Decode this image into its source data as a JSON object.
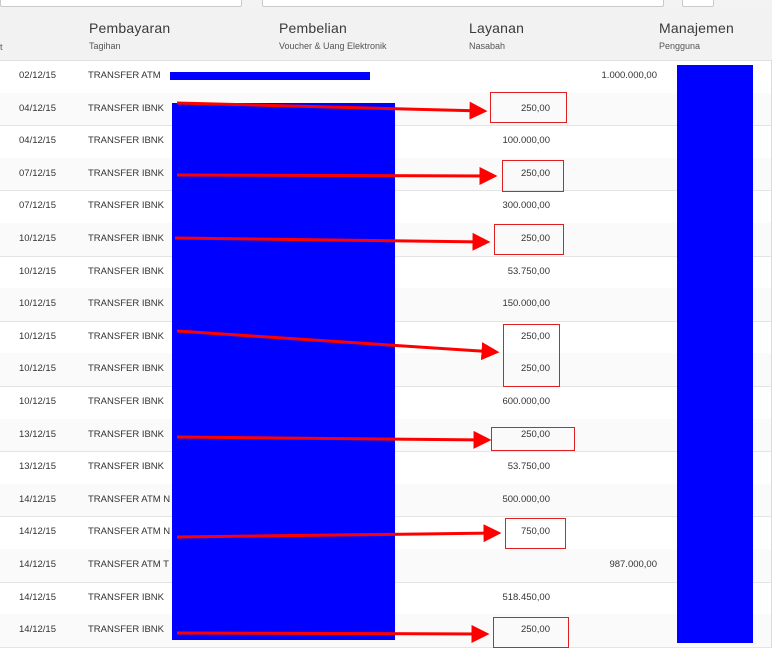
{
  "header": {
    "menus": [
      {
        "label": "Pembayaran",
        "sub": "Tagihan"
      },
      {
        "label": "Pembelian",
        "sub": "Voucher & Uang Elektronik"
      },
      {
        "label": "Layanan",
        "sub": "Nasabah"
      },
      {
        "label": "Manajemen",
        "sub": "Pengguna"
      }
    ],
    "edge_glyph": "t"
  },
  "rows": [
    {
      "date": "02/12/15",
      "desc": "TRANSFER ATM",
      "amount": "",
      "credit": "1.000.000,00"
    },
    {
      "date": "04/12/15",
      "desc": "TRANSFER IBNK",
      "amount": "250,00",
      "credit": ""
    },
    {
      "date": "04/12/15",
      "desc": "TRANSFER IBNK",
      "amount": "100.000,00",
      "credit": ""
    },
    {
      "date": "07/12/15",
      "desc": "TRANSFER IBNK",
      "amount": "250,00",
      "credit": ""
    },
    {
      "date": "07/12/15",
      "desc": "TRANSFER IBNK",
      "amount": "300.000,00",
      "credit": ""
    },
    {
      "date": "10/12/15",
      "desc": "TRANSFER IBNK",
      "amount": "250,00",
      "credit": ""
    },
    {
      "date": "10/12/15",
      "desc": "TRANSFER IBNK",
      "amount": "53.750,00",
      "credit": ""
    },
    {
      "date": "10/12/15",
      "desc": "TRANSFER IBNK",
      "amount": "150.000,00",
      "credit": ""
    },
    {
      "date": "10/12/15",
      "desc": "TRANSFER IBNK",
      "amount": "250,00",
      "credit": ""
    },
    {
      "date": "10/12/15",
      "desc": "TRANSFER IBNK",
      "amount": "250,00",
      "credit": ""
    },
    {
      "date": "10/12/15",
      "desc": "TRANSFER IBNK",
      "amount": "600.000,00",
      "credit": ""
    },
    {
      "date": "13/12/15",
      "desc": "TRANSFER IBNK",
      "amount": "250,00",
      "credit": ""
    },
    {
      "date": "13/12/15",
      "desc": "TRANSFER IBNK",
      "amount": "53.750,00",
      "credit": ""
    },
    {
      "date": "14/12/15",
      "desc": "TRANSFER ATM N",
      "amount": "500.000,00",
      "credit": ""
    },
    {
      "date": "14/12/15",
      "desc": "TRANSFER ATM N",
      "amount": "750,00",
      "credit": ""
    },
    {
      "date": "14/12/15",
      "desc": "TRANSFER ATM T",
      "amount": "",
      "credit": "987.000,00"
    },
    {
      "date": "14/12/15",
      "desc": "TRANSFER IBNK",
      "amount": "518.450,00",
      "credit": ""
    },
    {
      "date": "14/12/15",
      "desc": "TRANSFER IBNK",
      "amount": "250,00",
      "credit": ""
    }
  ],
  "colors": {
    "redaction": "#0000ff",
    "annotation": "#ff0000"
  }
}
